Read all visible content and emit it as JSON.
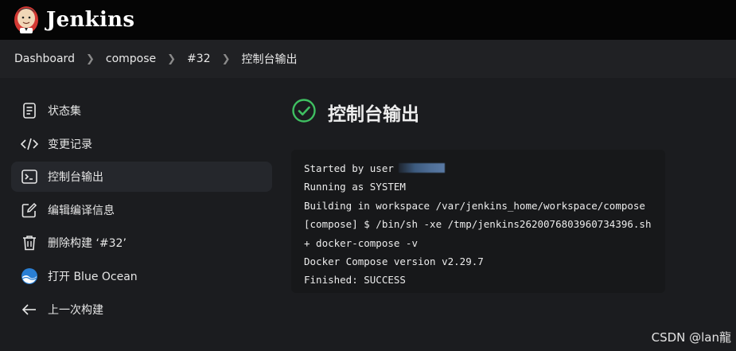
{
  "header": {
    "brand": "Jenkins",
    "logo_icon": "jenkins-butler-icon"
  },
  "breadcrumb": {
    "items": [
      "Dashboard",
      "compose",
      "#32",
      "控制台输出"
    ],
    "separator": ">"
  },
  "sidebar": {
    "items": [
      {
        "label": "状态集",
        "icon": "notepad-icon"
      },
      {
        "label": "变更记录",
        "icon": "code-icon"
      },
      {
        "label": "控制台输出",
        "icon": "terminal-icon",
        "active": true
      },
      {
        "label": "编辑编译信息",
        "icon": "edit-icon"
      },
      {
        "label": "删除构建 ‘#32’",
        "icon": "trash-icon"
      },
      {
        "label": "打开 Blue Ocean",
        "icon": "blue-ocean-icon"
      },
      {
        "label": "上一次构建",
        "icon": "arrow-left-icon"
      }
    ]
  },
  "main": {
    "title": "控制台输出",
    "status_icon": "success-check-icon",
    "status_color": "#3fbf61",
    "console_lines": [
      "Started by user",
      "Running as SYSTEM",
      "Building in workspace /var/jenkins_home/workspace/compose",
      "[compose] $ /bin/sh -xe /tmp/jenkins2620076803960734396.sh",
      "+ docker-compose -v",
      "Docker Compose version v2.29.7",
      "Finished: SUCCESS"
    ]
  },
  "watermark": "CSDN @lan龍"
}
